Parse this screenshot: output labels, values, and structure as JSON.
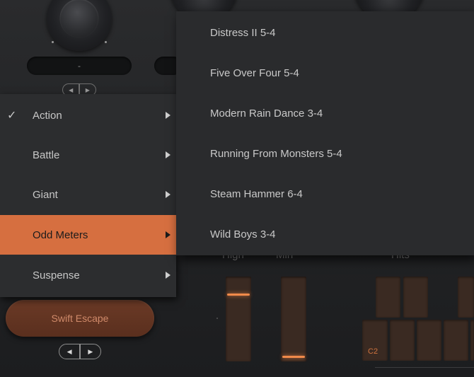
{
  "colors": {
    "accent": "#d66f40",
    "menu_bg": "#2c2d2f",
    "submenu_bg": "#2a2b2d",
    "text": "#c7c7c7",
    "glow": "#f08a4a"
  },
  "display_value": "-",
  "current_preset": "Swift Escape",
  "slots": {
    "high_label": "High",
    "min_label": "Min",
    "hits_label": "Hits",
    "pad_note": "C2"
  },
  "sliders": {
    "high_level": 0.8,
    "min_level": 0.03
  },
  "category_menu": {
    "items": [
      {
        "label": "Action",
        "checked": true,
        "active": false
      },
      {
        "label": "Battle",
        "checked": false,
        "active": false
      },
      {
        "label": "Giant",
        "checked": false,
        "active": false
      },
      {
        "label": "Odd Meters",
        "checked": false,
        "active": true
      },
      {
        "label": "Suspense",
        "checked": false,
        "active": false
      }
    ],
    "check_glyph": "✓"
  },
  "submenu": {
    "items": [
      {
        "label": "Distress II 5-4"
      },
      {
        "label": "Five Over Four 5-4"
      },
      {
        "label": "Modern Rain Dance 3-4"
      },
      {
        "label": "Running From Monsters 5-4"
      },
      {
        "label": "Steam Hammer 6-4"
      },
      {
        "label": "Wild Boys 3-4"
      }
    ]
  },
  "icons": {
    "left": "◀",
    "right": "▶"
  }
}
